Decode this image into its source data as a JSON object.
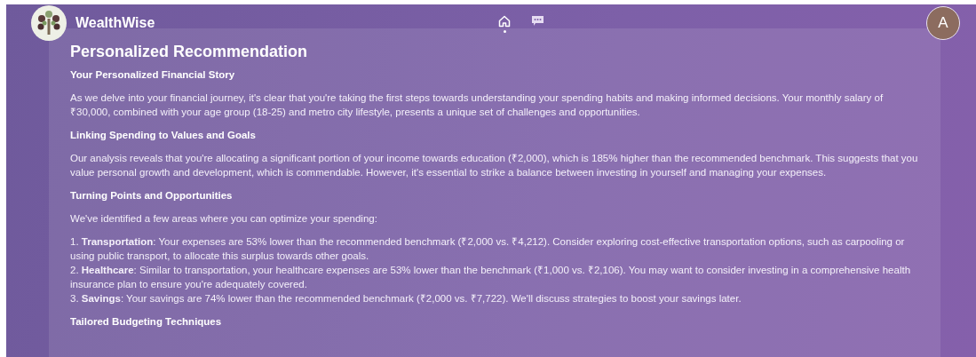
{
  "header": {
    "brand": "WealthWise",
    "nav": [
      {
        "kind": "home",
        "selected": true
      },
      {
        "kind": "chat",
        "selected": false
      }
    ],
    "avatar": "A"
  },
  "content": {
    "title": "Personalized Recommendation",
    "blocks": [
      {
        "kind": "heading",
        "text": "Your Personalized Financial Story"
      },
      {
        "kind": "paragraph",
        "text": "As we delve into your financial journey, it's clear that you're taking the first steps towards understanding your spending habits and making informed decisions. Your monthly salary of ₹30,000, combined with your age group (18-25) and metro city lifestyle, presents a unique set of challenges and opportunities."
      },
      {
        "kind": "heading",
        "text": "Linking Spending to Values and Goals"
      },
      {
        "kind": "paragraph",
        "text": "Our analysis reveals that you're allocating a significant portion of your income towards education (₹2,000), which is 185% higher than the recommended benchmark. This suggests that you value personal growth and development, which is commendable. However, it's essential to strike a balance between investing in yourself and managing your expenses."
      },
      {
        "kind": "heading",
        "text": "Turning Points and Opportunities"
      },
      {
        "kind": "paragraph",
        "text": "We've identified a few areas where you can optimize your spending:"
      },
      {
        "kind": "list",
        "items": [
          "1. **Transportation**: Your expenses are 53% lower than the recommended benchmark (₹2,000 vs. ₹4,212). Consider exploring cost-effective transportation options, such as carpooling or using public transport, to allocate this surplus towards other goals.",
          "2. **Healthcare**: Similar to transportation, your healthcare expenses are 53% lower than the benchmark (₹1,000 vs. ₹2,106). You may want to consider investing in a comprehensive health insurance plan to ensure you're adequately covered.",
          "3. **Savings**: Your savings are 74% lower than the recommended benchmark (₹2,000 vs. ₹7,722). We'll discuss strategies to boost your savings later."
        ]
      },
      {
        "kind": "heading",
        "text": "Tailored Budgeting Techniques"
      }
    ]
  }
}
